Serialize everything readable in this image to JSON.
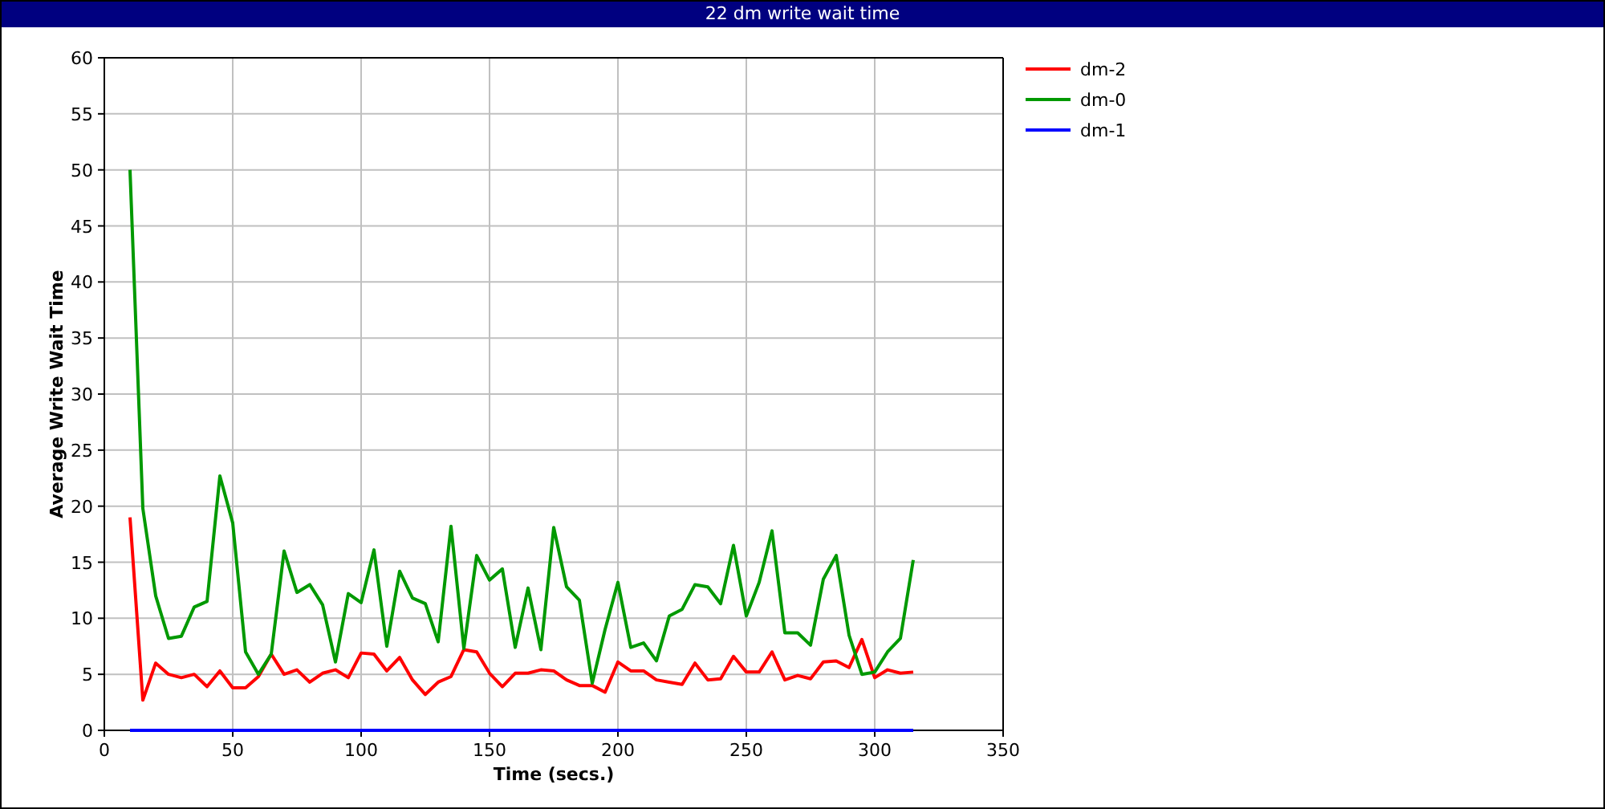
{
  "window": {
    "title": "22 dm write wait time"
  },
  "chart": {
    "chart_data": {
      "type": "line",
      "grid": true,
      "legend": true,
      "xlabel": "Time (secs.)",
      "ylabel": "Average Write Wait Time",
      "xlim": [
        0,
        350
      ],
      "ylim": [
        0,
        60
      ],
      "xticks": [
        0,
        50,
        100,
        150,
        200,
        250,
        300,
        350
      ],
      "yticks": [
        0,
        5,
        10,
        15,
        20,
        25,
        30,
        35,
        40,
        45,
        50,
        55,
        60
      ],
      "x": [
        10,
        15,
        20,
        25,
        30,
        35,
        40,
        45,
        50,
        55,
        60,
        65,
        70,
        75,
        80,
        85,
        90,
        95,
        100,
        105,
        110,
        115,
        120,
        125,
        130,
        135,
        140,
        145,
        150,
        155,
        160,
        165,
        170,
        175,
        180,
        185,
        190,
        195,
        200,
        205,
        210,
        215,
        220,
        225,
        230,
        235,
        240,
        245,
        250,
        255,
        260,
        265,
        270,
        275,
        280,
        285,
        290,
        295,
        300,
        305,
        310,
        315
      ],
      "series": [
        {
          "name": "dm-2",
          "color": "#ff0000",
          "values": [
            19,
            2.7,
            6,
            5,
            4.7,
            5,
            3.9,
            5.3,
            3.8,
            3.8,
            4.8,
            6.8,
            5,
            5.4,
            4.3,
            5.1,
            5.4,
            4.7,
            6.9,
            6.8,
            5.3,
            6.5,
            4.5,
            3.2,
            4.3,
            4.8,
            7.2,
            7,
            5.1,
            3.9,
            5.1,
            5.1,
            5.4,
            5.3,
            4.5,
            4,
            4,
            3.4,
            6.1,
            5.3,
            5.3,
            4.5,
            4.3,
            4.1,
            6,
            4.5,
            4.6,
            6.6,
            5.2,
            5.2,
            7,
            4.5,
            4.9,
            4.6,
            6.1,
            6.2,
            5.6,
            8.1,
            4.7,
            5.4,
            5.1,
            5.2
          ]
        },
        {
          "name": "dm-0",
          "color": "#009900",
          "values": [
            50,
            19.8,
            12,
            8.2,
            8.4,
            11,
            11.5,
            22.7,
            18.5,
            7,
            5,
            6.8,
            16,
            12.3,
            13,
            11.2,
            6.1,
            12.2,
            11.4,
            16.1,
            7.5,
            14.2,
            11.8,
            11.3,
            7.9,
            18.2,
            7.3,
            15.6,
            13.4,
            14.4,
            7.4,
            12.7,
            7.2,
            18.1,
            12.8,
            11.6,
            4.2,
            9,
            13.2,
            7.4,
            7.8,
            6.2,
            10.2,
            10.8,
            13,
            12.8,
            11.3,
            16.5,
            10.2,
            13.2,
            17.8,
            8.7,
            8.7,
            7.6,
            13.5,
            15.6,
            8.5,
            5,
            5.2,
            7,
            8.2,
            15.2
          ]
        },
        {
          "name": "dm-1",
          "color": "#0000ff",
          "values": [
            0,
            0,
            0,
            0,
            0,
            0,
            0,
            0,
            0,
            0,
            0,
            0,
            0,
            0,
            0,
            0,
            0,
            0,
            0,
            0,
            0,
            0,
            0,
            0,
            0,
            0,
            0,
            0,
            0,
            0,
            0,
            0,
            0,
            0,
            0,
            0,
            0,
            0,
            0,
            0,
            0,
            0,
            0,
            0,
            0,
            0,
            0,
            0,
            0,
            0,
            0,
            0,
            0,
            0,
            0,
            0,
            0,
            0,
            0,
            0,
            0,
            0
          ]
        }
      ]
    }
  }
}
